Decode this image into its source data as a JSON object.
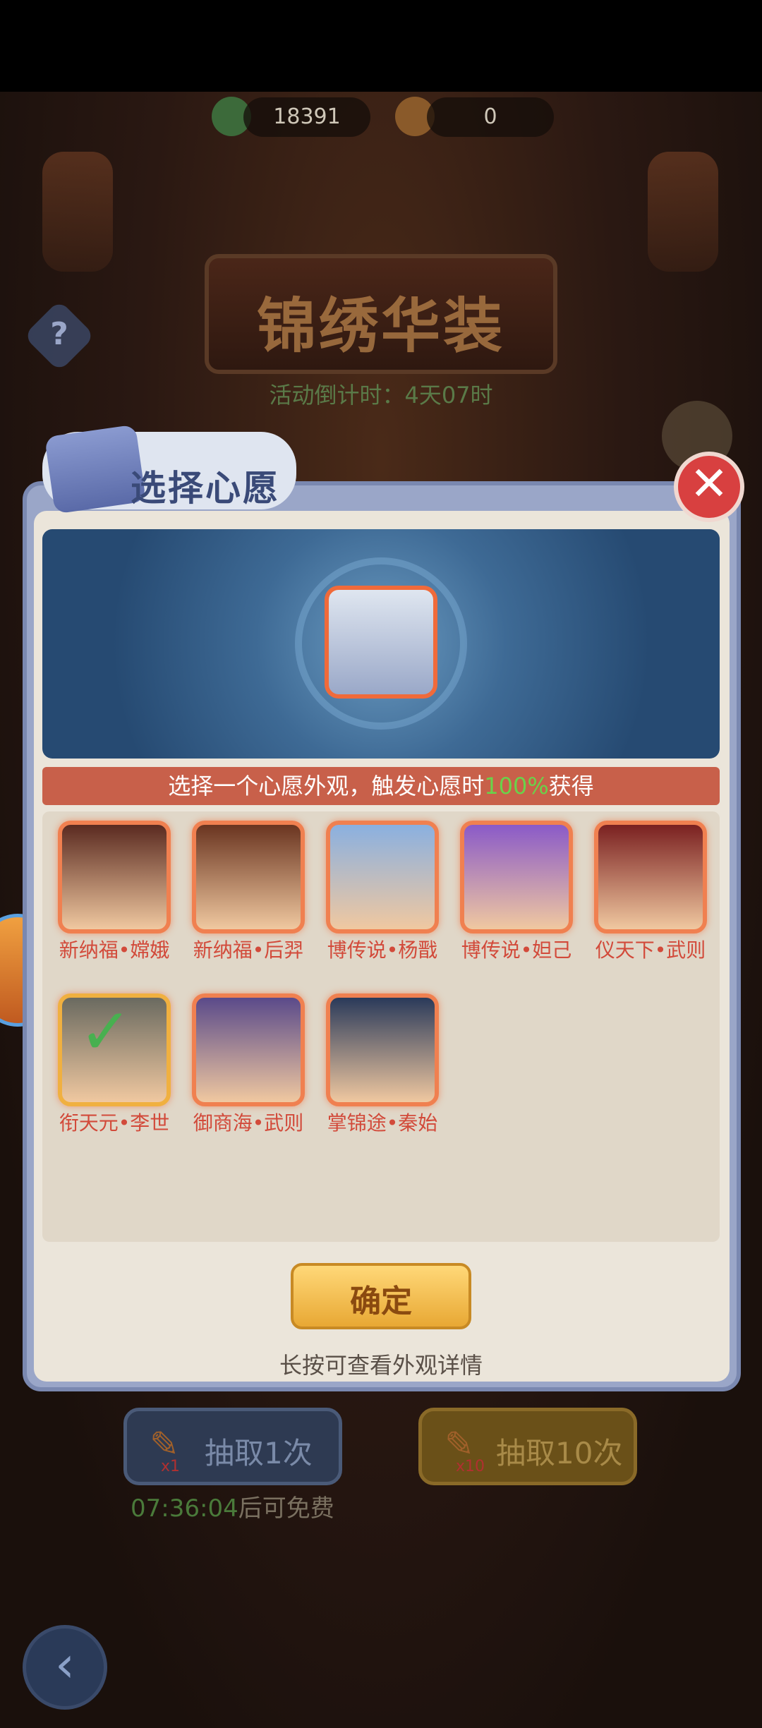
{
  "header": {
    "gem_count": "18391",
    "feather_count": "0"
  },
  "event": {
    "title": "锦绣华装",
    "countdown": "活动倒计时：4天07时"
  },
  "dialog": {
    "title": "选择心愿",
    "instruction_prefix": "选择一个心愿外观，触发心愿时",
    "instruction_percent": "100%",
    "instruction_suffix": "获得",
    "confirm_label": "确定",
    "hint": "长按可查看外观详情"
  },
  "skins": [
    {
      "name": "新纳福•嫦娥",
      "selected": false,
      "color": "#5a2a20"
    },
    {
      "name": "新纳福•后羿",
      "selected": false,
      "color": "#6a3420"
    },
    {
      "name": "博传说•杨戬",
      "selected": false,
      "color": "#8ab0e0"
    },
    {
      "name": "博传说•妲己",
      "selected": false,
      "color": "#8a5ac8"
    },
    {
      "name": "仪天下•武则",
      "selected": false,
      "color": "#7a2020"
    },
    {
      "name": "衔天元•李世",
      "selected": true,
      "color": "#6a6a60"
    },
    {
      "name": "御商海•武则",
      "selected": false,
      "color": "#5a4a8a"
    },
    {
      "name": "掌锦途•秦始",
      "selected": false,
      "color": "#2a3a5a"
    }
  ],
  "draw": {
    "single_label": "抽取1次",
    "single_mult": "x1",
    "ten_label": "抽取10次",
    "ten_mult": "x10",
    "free_time": "07:36:04",
    "free_suffix": "后可免费"
  },
  "colors": {
    "accent_red": "#d24a3a",
    "accent_green": "#6ad24a",
    "dialog_blue": "#7a88b0"
  },
  "icons": {
    "gem": "gem-icon",
    "feather": "feather-icon",
    "help": "help-icon",
    "close": "close-icon",
    "back": "back-icon",
    "check": "check-icon"
  }
}
